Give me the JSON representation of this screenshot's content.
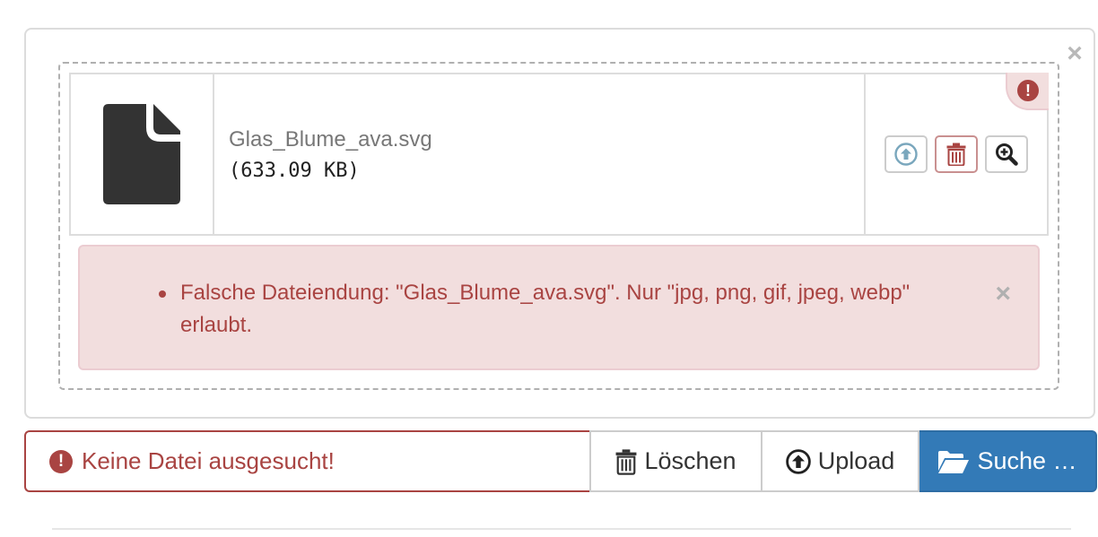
{
  "preview": {
    "close_label": "×",
    "file": {
      "icon": "file-icon",
      "name": "Glas_Blume_ava.svg",
      "size": "(633.09 KB)",
      "error_icon": "exclamation-circle-icon",
      "error_icon_label": "!",
      "actions": [
        {
          "name": "upload-file-button",
          "icon": "upload-circle-icon"
        },
        {
          "name": "delete-file-button",
          "icon": "trash-icon"
        },
        {
          "name": "zoom-file-button",
          "icon": "zoom-in-icon"
        }
      ]
    },
    "error_alert": {
      "messages": [
        "Falsche Dateiendung: \"Glas_Blume_ava.svg\". Nur \"jpg, png, gif, jpeg, webp\" erlaubt."
      ],
      "close_label": "×"
    }
  },
  "input_group": {
    "caption_icon": "exclamation-circle-icon",
    "caption_icon_label": "!",
    "caption": "Keine Datei ausgesucht!",
    "delete_label": "Löschen",
    "upload_label": "Upload",
    "browse_label": "Suche …"
  },
  "colors": {
    "error_text": "#a94442",
    "error_bg": "#f2dede",
    "primary": "#337ab7"
  }
}
